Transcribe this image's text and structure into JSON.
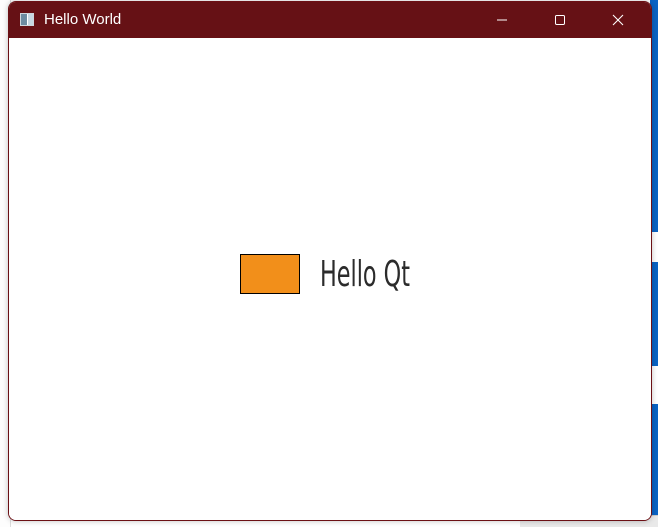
{
  "window": {
    "title": "Hello World",
    "colors": {
      "titlebar": "#661115",
      "title_text": "#ffffff",
      "content_bg": "#ffffff"
    },
    "controls": {
      "minimize_icon": "minimize-icon",
      "maximize_icon": "maximize-icon",
      "close_icon": "close-icon"
    }
  },
  "content": {
    "swatch_color": "#f28f1a",
    "label": "Hello Qt"
  }
}
